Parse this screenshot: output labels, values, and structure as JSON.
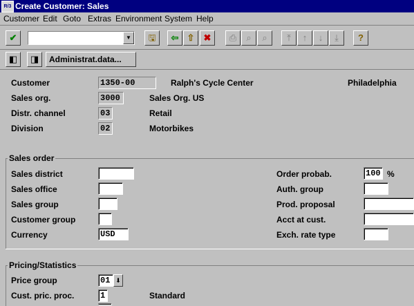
{
  "window": {
    "title": "Create Customer: Sales",
    "sys_icon_text": "R/3"
  },
  "menu": [
    "Customer",
    "Edit",
    "Goto",
    "Extras",
    "Environment",
    "System",
    "Help"
  ],
  "toolbar": {
    "command_value": ""
  },
  "app_toolbar": {
    "admin_button": "Administrat.data..."
  },
  "header": {
    "customer_label": "Customer",
    "customer_value": "1350-00",
    "customer_name": "Ralph's Cycle Center",
    "customer_city": "Philadelphia",
    "salesorg_label": "Sales org.",
    "salesorg_value": "3000",
    "salesorg_text": "Sales Org. US",
    "distr_label": "Distr. channel",
    "distr_value": "03",
    "distr_text": "Retail",
    "division_label": "Division",
    "division_value": "02",
    "division_text": "Motorbikes"
  },
  "sales_order": {
    "title": "Sales order",
    "sales_district_label": "Sales district",
    "sales_district_value": "",
    "sales_office_label": "Sales office",
    "sales_office_value": "",
    "sales_group_label": "Sales group",
    "sales_group_value": "",
    "customer_group_label": "Customer group",
    "customer_group_value": "",
    "currency_label": "Currency",
    "currency_value": "USD",
    "order_probab_label": "Order probab.",
    "order_probab_value": "100",
    "order_probab_unit": "%",
    "auth_group_label": "Auth. group",
    "auth_group_value": "",
    "prod_proposal_label": "Prod. proposal",
    "prod_proposal_value": "",
    "acct_label": "Acct at cust.",
    "acct_value": "",
    "exch_label": "Exch. rate type",
    "exch_value": ""
  },
  "pricing": {
    "title": "Pricing/Statistics",
    "price_group_label": "Price group",
    "price_group_value": "01",
    "cust_pric_label": "Cust. pric. proc.",
    "cust_pric_value": "1",
    "cust_pric_text": "Standard"
  }
}
